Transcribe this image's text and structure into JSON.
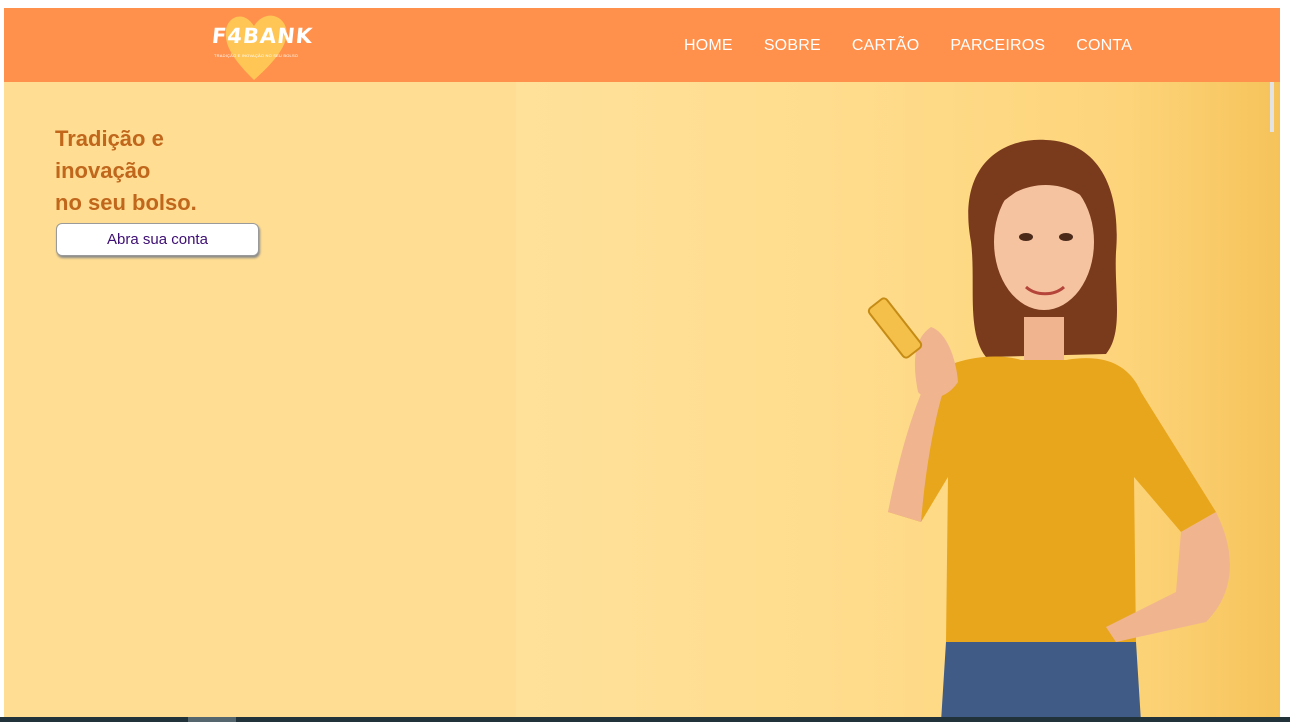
{
  "brand": {
    "name": "F4BANK",
    "tagline": "TRADIÇÃO E INOVAÇÃO NO SEU BOLSO",
    "heart_color": "#ffc956"
  },
  "nav": {
    "items": [
      {
        "label": "HOME"
      },
      {
        "label": "SOBRE"
      },
      {
        "label": "CARTÃO"
      },
      {
        "label": "PARCEIROS"
      },
      {
        "label": "CONTA"
      }
    ]
  },
  "hero": {
    "headline_line1": "Tradição e",
    "headline_line2": "inovação",
    "headline_line3": "no seu bolso.",
    "cta_label": "Abra sua conta",
    "image_subject": "woman-in-yellow-shirt-holding-phone"
  },
  "colors": {
    "navbar": "#ff914d",
    "hero_bg": "#ffdd92",
    "headline": "#c0671c",
    "cta_text": "#3d0e73"
  }
}
